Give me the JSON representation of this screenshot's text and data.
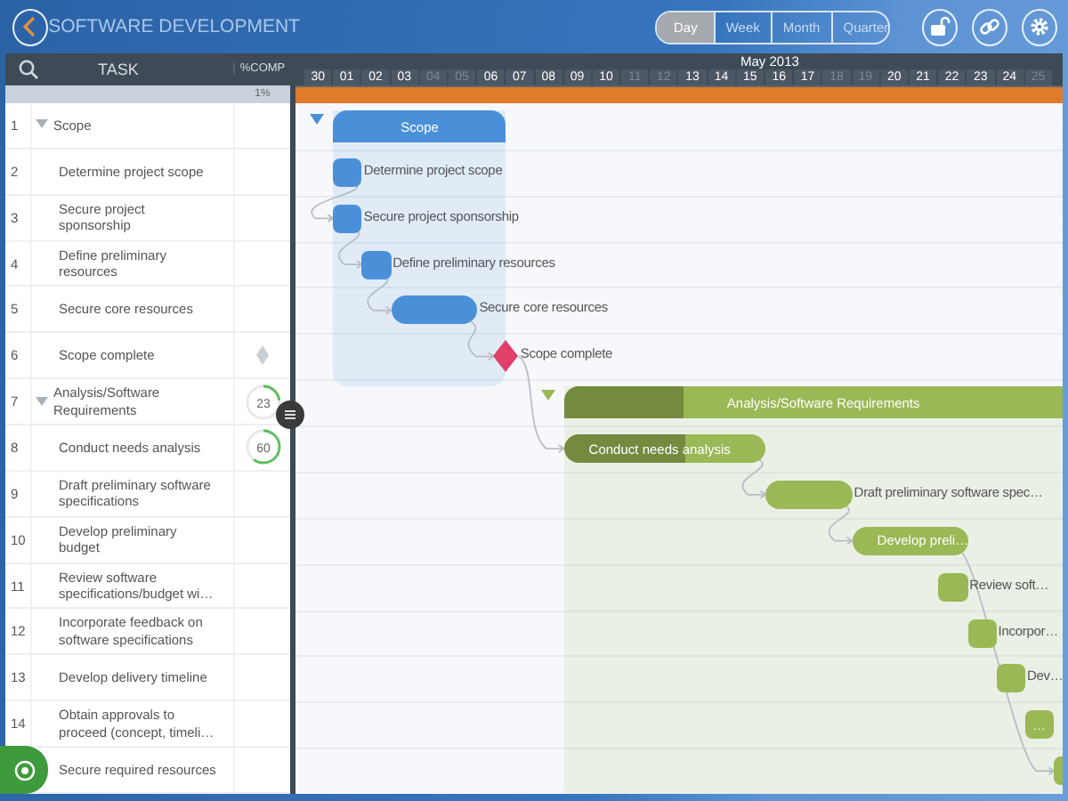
{
  "header": {
    "title": "SOFTWARE DEVELOPMENT",
    "views": [
      {
        "label": "Day",
        "selected": true
      },
      {
        "label": "Week",
        "selected": false
      },
      {
        "label": "Month",
        "selected": false
      },
      {
        "label": "Quarter",
        "selected": false
      }
    ]
  },
  "columns": {
    "task": "TASK",
    "complete": "%COMP",
    "project_complete": "1%"
  },
  "timeline": {
    "month": "May 2013",
    "days": [
      {
        "label": "30",
        "weekend": false
      },
      {
        "label": "01",
        "weekend": false
      },
      {
        "label": "02",
        "weekend": false
      },
      {
        "label": "03",
        "weekend": false
      },
      {
        "label": "04",
        "weekend": true
      },
      {
        "label": "05",
        "weekend": true
      },
      {
        "label": "06",
        "weekend": false
      },
      {
        "label": "07",
        "weekend": false
      },
      {
        "label": "08",
        "weekend": false
      },
      {
        "label": "09",
        "weekend": false
      },
      {
        "label": "10",
        "weekend": false
      },
      {
        "label": "11",
        "weekend": true
      },
      {
        "label": "12",
        "weekend": true
      },
      {
        "label": "13",
        "weekend": false
      },
      {
        "label": "14",
        "weekend": false
      },
      {
        "label": "15",
        "weekend": false
      },
      {
        "label": "16",
        "weekend": false
      },
      {
        "label": "17",
        "weekend": false
      },
      {
        "label": "18",
        "weekend": true
      },
      {
        "label": "19",
        "weekend": true
      },
      {
        "label": "20",
        "weekend": false
      },
      {
        "label": "21",
        "weekend": false
      },
      {
        "label": "22",
        "weekend": false
      },
      {
        "label": "23",
        "weekend": false
      },
      {
        "label": "24",
        "weekend": false
      },
      {
        "label": "25",
        "weekend": true
      }
    ]
  },
  "tasks": [
    {
      "num": "1",
      "name": "Scope",
      "kind": "summary",
      "expanded": true,
      "color": "#4a90d9",
      "bar_label": "Scope",
      "children": [
        {
          "num": "2",
          "name": "Determine project scope",
          "kind": "task",
          "bar_label": "Determine project scope"
        },
        {
          "num": "3",
          "name": "Secure project sponsorship",
          "kind": "task",
          "bar_label": "Secure project sponsorship"
        },
        {
          "num": "4",
          "name": "Define preliminary resources",
          "kind": "task",
          "bar_label": "Define preliminary resources"
        },
        {
          "num": "5",
          "name": "Secure core resources",
          "kind": "task",
          "bar_label": "Secure core resources"
        },
        {
          "num": "6",
          "name": "Scope complete",
          "kind": "milestone",
          "bar_label": "Scope complete"
        }
      ]
    },
    {
      "num": "7",
      "name": "Analysis/Software Requirements",
      "kind": "summary",
      "expanded": true,
      "color": "#9ab855",
      "pct": "23",
      "level": 0.23,
      "bar_label": "Analysis/Software Requirements",
      "children": [
        {
          "num": "8",
          "name": "Conduct needs analysis",
          "kind": "task",
          "pct": "60",
          "level": 0.6,
          "bar_label": "Conduct needs analysis"
        },
        {
          "num": "9",
          "name": "Draft preliminary software specifications",
          "kind": "task",
          "bar_label": "Draft preliminary software spec…"
        },
        {
          "num": "10",
          "name": "Develop preliminary budget",
          "kind": "task",
          "bar_label": "Develop preli…"
        },
        {
          "num": "11",
          "name": "Review software specifications/budget wi…",
          "kind": "task",
          "bar_label": "Review soft…"
        },
        {
          "num": "12",
          "name": "Incorporate feedback on software specifications",
          "kind": "task",
          "bar_label": "Incorpor…"
        },
        {
          "num": "13",
          "name": "Develop delivery timeline",
          "kind": "task",
          "bar_label": "Dev…"
        },
        {
          "num": "14",
          "name": "Obtain approvals to proceed (concept, timeli…",
          "kind": "task",
          "bar_label": "…"
        },
        {
          "name": "Secure required resources",
          "kind": "task"
        }
      ]
    }
  ]
}
